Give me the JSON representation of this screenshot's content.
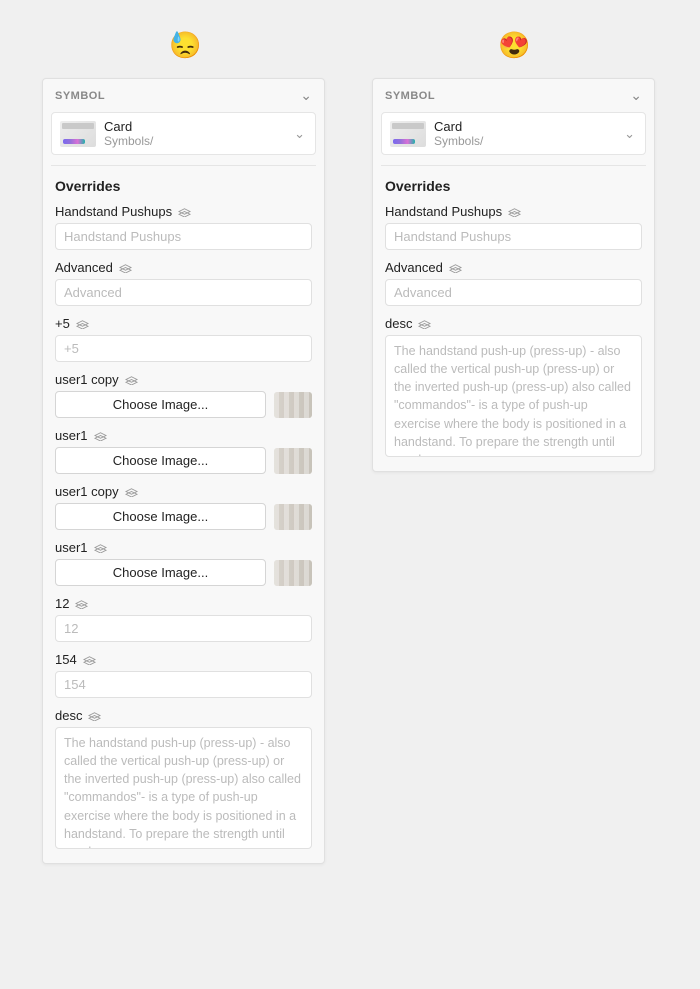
{
  "emojis": {
    "left": "😓",
    "right": "😍"
  },
  "left": {
    "section": "SYMBOL",
    "symbol": {
      "name": "Card",
      "path": "Symbols/"
    },
    "overrides_title": "Overrides",
    "fields": {
      "handstand": {
        "label": "Handstand Pushups",
        "placeholder": "Handstand Pushups"
      },
      "advanced": {
        "label": "Advanced",
        "placeholder": "Advanced"
      },
      "plus5": {
        "label": "+5",
        "placeholder": "+5"
      },
      "user1copyA": {
        "label": "user1 copy",
        "button": "Choose Image..."
      },
      "user1A": {
        "label": "user1",
        "button": "Choose Image..."
      },
      "user1copyB": {
        "label": "user1 copy",
        "button": "Choose Image..."
      },
      "user1B": {
        "label": "user1",
        "button": "Choose Image..."
      },
      "n12": {
        "label": "12",
        "placeholder": "12"
      },
      "n154": {
        "label": "154",
        "placeholder": "154"
      },
      "desc": {
        "label": "desc",
        "placeholder": "The handstand push-up (press-up) - also called the vertical push-up (press-up) or the inverted push-up (press-up) also called \"commandos\"- is a type of push-up exercise where the body is positioned in a handstand.\nTo prepare the strength until one has"
      }
    }
  },
  "right": {
    "section": "SYMBOL",
    "symbol": {
      "name": "Card",
      "path": "Symbols/"
    },
    "overrides_title": "Overrides",
    "fields": {
      "handstand": {
        "label": "Handstand Pushups",
        "placeholder": "Handstand Pushups"
      },
      "advanced": {
        "label": "Advanced",
        "placeholder": "Advanced"
      },
      "desc": {
        "label": "desc",
        "placeholder": "The handstand push-up (press-up) - also called the vertical push-up (press-up) or the inverted push-up (press-up) also called \"commandos\"- is a type of push-up exercise where the body is positioned in a handstand.\nTo prepare the strength until one has"
      }
    }
  }
}
